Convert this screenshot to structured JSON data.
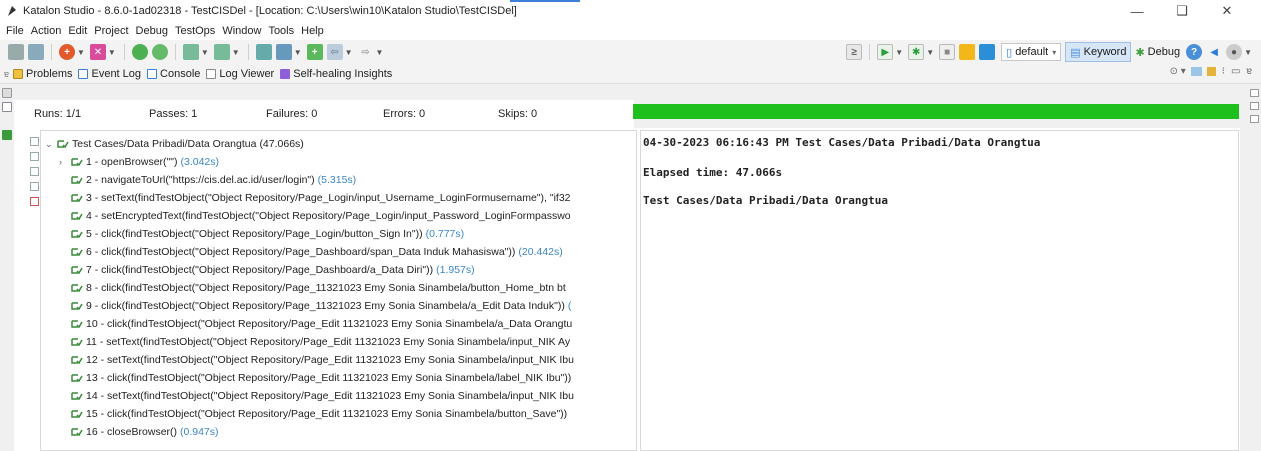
{
  "window": {
    "title": "Katalon Studio - 8.6.0-1ad02318 - TestCISDel - [Location: C:\\Users\\win10\\Katalon Studio\\TestCISDel]",
    "minimize": "—",
    "maximize": "❑",
    "close": "✕"
  },
  "menu": [
    "File",
    "Action",
    "Edit",
    "Project",
    "Debug",
    "TestOps",
    "Window",
    "Tools",
    "Help"
  ],
  "toolbar": {
    "profile": "default",
    "keyword_label": "Keyword",
    "debug_label": "Debug"
  },
  "view_tabs": [
    "Problems",
    "Event Log",
    "Console",
    "Log Viewer",
    "Self-healing Insights"
  ],
  "counters": {
    "runs": "Runs: 1/1",
    "passes": "Passes: 1",
    "failures": "Failures: 0",
    "errors": "Errors: 0",
    "skips": "Skips: 0"
  },
  "progress": {
    "fraction": 1.0,
    "color": "#1ec01e"
  },
  "tree": {
    "root": {
      "label": "Test Cases/Data Pribadi/Data Orangtua",
      "duration": "(47.066s)"
    },
    "steps": [
      {
        "label": "1 - openBrowser(\"\")",
        "duration": "(3.042s)",
        "expandable": true
      },
      {
        "label": "2 - navigateToUrl(\"https://cis.del.ac.id/user/login\")",
        "duration": "(5.315s)"
      },
      {
        "label": "3 - setText(findTestObject(\"Object Repository/Page_Login/input_Username_LoginFormusername\"), \"if32",
        "duration": ""
      },
      {
        "label": "4 - setEncryptedText(findTestObject(\"Object Repository/Page_Login/input_Password_LoginFormpasswo",
        "duration": ""
      },
      {
        "label": "5 - click(findTestObject(\"Object Repository/Page_Login/button_Sign In\"))",
        "duration": "(0.777s)"
      },
      {
        "label": "6 - click(findTestObject(\"Object Repository/Page_Dashboard/span_Data Induk Mahasiswa\"))",
        "duration": "(20.442s)"
      },
      {
        "label": "7 - click(findTestObject(\"Object Repository/Page_Dashboard/a_Data Diri\"))",
        "duration": "(1.957s)"
      },
      {
        "label": "8 - click(findTestObject(\"Object Repository/Page_11321023 Emy Sonia Sinambela/button_Home_btn bt",
        "duration": ""
      },
      {
        "label": "9 - click(findTestObject(\"Object Repository/Page_11321023 Emy Sonia Sinambela/a_Edit Data Induk\"))",
        "duration": "("
      },
      {
        "label": "10 - click(findTestObject(\"Object Repository/Page_Edit 11321023 Emy Sonia Sinambela/a_Data Orangtu",
        "duration": ""
      },
      {
        "label": "11 - setText(findTestObject(\"Object Repository/Page_Edit 11321023 Emy Sonia Sinambela/input_NIK Ay",
        "duration": ""
      },
      {
        "label": "12 - setText(findTestObject(\"Object Repository/Page_Edit 11321023 Emy Sonia Sinambela/input_NIK Ibu",
        "duration": ""
      },
      {
        "label": "13 - click(findTestObject(\"Object Repository/Page_Edit 11321023 Emy Sonia Sinambela/label_NIK Ibu\"))",
        "duration": ""
      },
      {
        "label": "14 - setText(findTestObject(\"Object Repository/Page_Edit 11321023 Emy Sonia Sinambela/input_NIK Ibu",
        "duration": ""
      },
      {
        "label": "15 - click(findTestObject(\"Object Repository/Page_Edit 11321023 Emy Sonia Sinambela/button_Save\"))",
        "duration": ""
      },
      {
        "label": "16 - closeBrowser()",
        "duration": "(0.947s)"
      }
    ]
  },
  "output": {
    "line1": "04-30-2023 06:16:43 PM Test Cases/Data Pribadi/Data Orangtua",
    "line2": "Elapsed time: 47.066s",
    "line3": "Test Cases/Data Pribadi/Data Orangtua"
  }
}
